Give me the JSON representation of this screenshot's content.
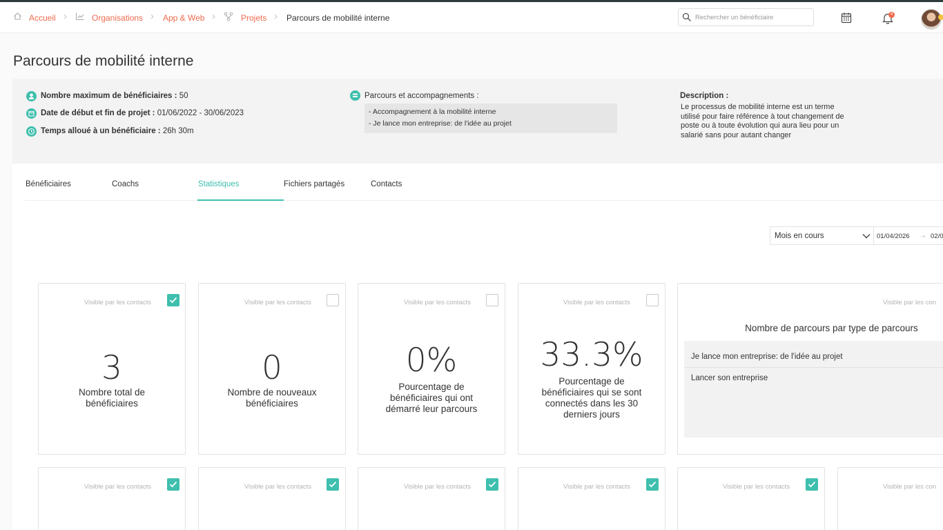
{
  "breadcrumb": {
    "items": [
      {
        "label": "Accueil",
        "icon": "home-icon"
      },
      {
        "label": "Organisations",
        "icon": "chart-icon"
      },
      {
        "label": "App & Web"
      },
      {
        "label": "Projets",
        "icon": "branch-icon"
      },
      {
        "label": "Parcours de mobilité interne"
      }
    ]
  },
  "header": {
    "search_placeholder": "Rechercher un bénéficiaire",
    "notifications_count": "4"
  },
  "page": {
    "title": "Parcours de mobilité interne"
  },
  "info": {
    "max_beneficiaries": {
      "label": "Nombre maximum de bénéficiaires :",
      "value": "50"
    },
    "dates": {
      "label": "Date de début et fin de projet :",
      "value": "01/06/2022 - 30/06/2023"
    },
    "time_allowed": {
      "label": "Temps alloué à un bénéficiaire :",
      "value": "26h 30m"
    },
    "parcours": {
      "label": "Parcours et accompagnements :",
      "items": [
        "- Accompagnement à la mobilité interne",
        "- Je lance mon entreprise: de l'idée au projet"
      ]
    },
    "description": {
      "label": "Description :",
      "text": "Le processus de mobilité interne est un terme utilisé pour faire référence à tout changement de poste ou à toute évolution qui aura lieu pour un salarié sans pour autant changer"
    }
  },
  "tabs": [
    "Bénéficiaires",
    "Coachs",
    "Statistiques",
    "Fichiers partagés",
    "Contacts"
  ],
  "filter": {
    "period": "Mois en cours",
    "date_start": "01/04/2026",
    "arrow": "→",
    "date_end": "02/0"
  },
  "cards": {
    "visible_label": "Visible par les contacts",
    "visible_label_cut": "Visible par les con",
    "stat1": {
      "value": "3",
      "caption": [
        "Nombre total de",
        "bénéficiaires"
      ]
    },
    "stat2": {
      "value": "0",
      "caption": [
        "Nombre de nouveaux",
        "bénéficiaires"
      ]
    },
    "stat3": {
      "value": "0%",
      "caption": [
        "Pourcentage de",
        "bénéficiaires qui ont",
        "démarré leur parcours"
      ]
    },
    "stat4": {
      "value": "33.3%",
      "caption": [
        "Pourcentage de",
        "bénéficiaires qui se sont",
        "connectés dans les 30",
        "derniers jours"
      ]
    },
    "chart": {
      "title": "Nombre de parcours par type de parcours",
      "rows": [
        "Je lance mon entreprise: de l'idée au projet",
        "Lancer son entreprise"
      ]
    }
  },
  "colors": {
    "accent": "#3fbfad",
    "link": "#ee6b4d"
  }
}
